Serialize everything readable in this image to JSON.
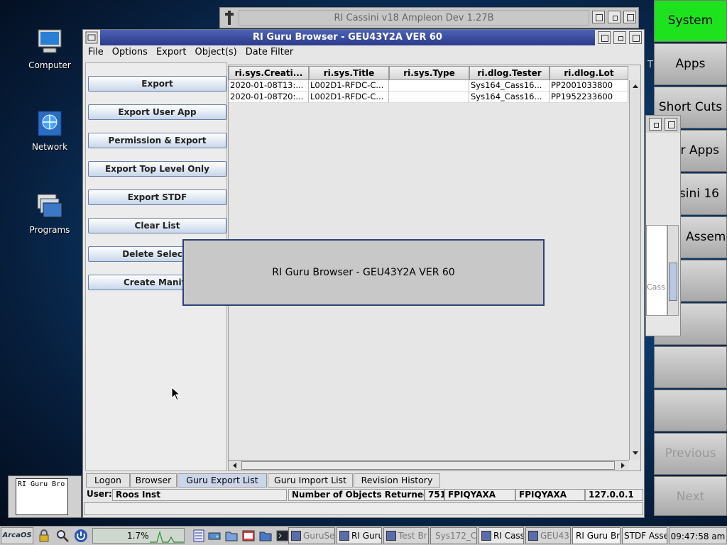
{
  "desktop": {
    "icons": [
      {
        "label": "Computer"
      },
      {
        "label": "Network"
      },
      {
        "label": "Programs"
      }
    ]
  },
  "bg_window": {
    "title": "RI Cassini v18  Ampleon Dev 1.27B"
  },
  "right_panel": {
    "buttons": [
      "System",
      "Apps",
      "Short Cuts",
      "r Apps",
      "ssini 16",
      " Assem",
      "",
      "",
      "",
      "",
      "Previous",
      "Next"
    ],
    "active_color": "#1fe21f"
  },
  "partial_window": {
    "cell_text": "Cass"
  },
  "main_window": {
    "title": "RI Guru Browser - GEU43Y2A  VER 60",
    "menu": [
      "File",
      "Options",
      "Export",
      "Object(s)",
      "Date Filter"
    ],
    "buttons": [
      "Export",
      "Export User App",
      "Permission & Export",
      "Export Top Level Only",
      "Export STDF",
      "Clear List",
      "Delete Selecte",
      "Create Manife"
    ],
    "table": {
      "columns": [
        "ri.sys.Creati...",
        "ri.sys.Title",
        "ri.sys.Type",
        "ri.dlog.Tester",
        "ri.dlog.Lot"
      ],
      "rows": [
        [
          "2020-01-08T13:...",
          "L002D1-RFDC-C...",
          "",
          "Sys164_Cass16...",
          "PP2001033800"
        ],
        [
          "2020-01-08T20:...",
          "L002D1-RFDC-C...",
          "",
          "Sys164_Cass16...",
          "PP1952233600"
        ]
      ]
    },
    "tabs": [
      "Logon",
      "Browser",
      "Guru Export List",
      "Guru Import List",
      "Revision History"
    ],
    "active_tab": "Guru Export List",
    "status": {
      "user_label": "User:",
      "user_value": "Roos Inst",
      "objects_label": "Number of Objects Returned =",
      "objects_value": "751",
      "field1": "FPIQYAXA",
      "field2": "FPIQYAXA",
      "ip": "127.0.0.1"
    }
  },
  "splash": {
    "text": "RI Guru Browser - GEU43Y2A  VER 60"
  },
  "thumbnail": {
    "label": "RI Guru Bro"
  },
  "side_letter": "T",
  "taskbar": {
    "start_label": "ArcaOS",
    "cpu": "1.7%",
    "tasks": [
      "GuruSe",
      "RI Guru",
      "Test Br",
      "Sys172_C",
      "RI Cass",
      "GEU43",
      "RI Guru Bro",
      "STDF Asse"
    ],
    "clock": "09:47:58 am"
  }
}
